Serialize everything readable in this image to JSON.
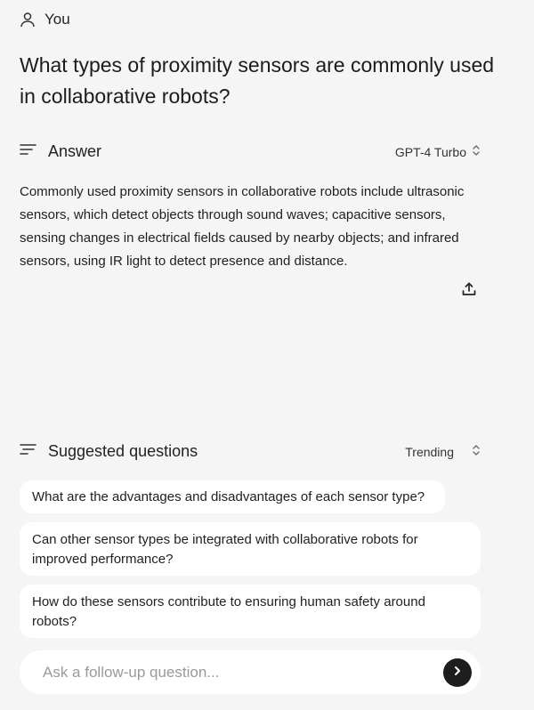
{
  "user": {
    "label": "You",
    "icon": "user-icon"
  },
  "question": "What types of proximity sensors are commonly used in collaborative robots?",
  "answer": {
    "heading": "Answer",
    "heading_icon": "lines-icon",
    "model": "GPT-4 Turbo",
    "model_icon": "chevron-up-down-icon",
    "text": "Commonly used proximity sensors in collaborative robots include ultrasonic sensors, which detect objects through sound waves; capacitive sensors, sensing changes in electrical fields caused by nearby objects; and infrared sensors, using IR light to detect presence and distance.",
    "share_icon": "share-icon"
  },
  "suggested": {
    "heading": "Suggested questions",
    "heading_icon": "lines-icon",
    "sort": "Trending",
    "sort_icon": "chevron-up-down-icon",
    "items": [
      "What are the advantages and disadvantages of each sensor type?",
      "Can other sensor types be integrated with collaborative robots for improved performance?",
      "How do these sensors contribute to ensuring human safety around robots?"
    ]
  },
  "followup": {
    "placeholder": "Ask a follow-up question...",
    "value": "",
    "send_icon": "chevron-right-icon"
  }
}
